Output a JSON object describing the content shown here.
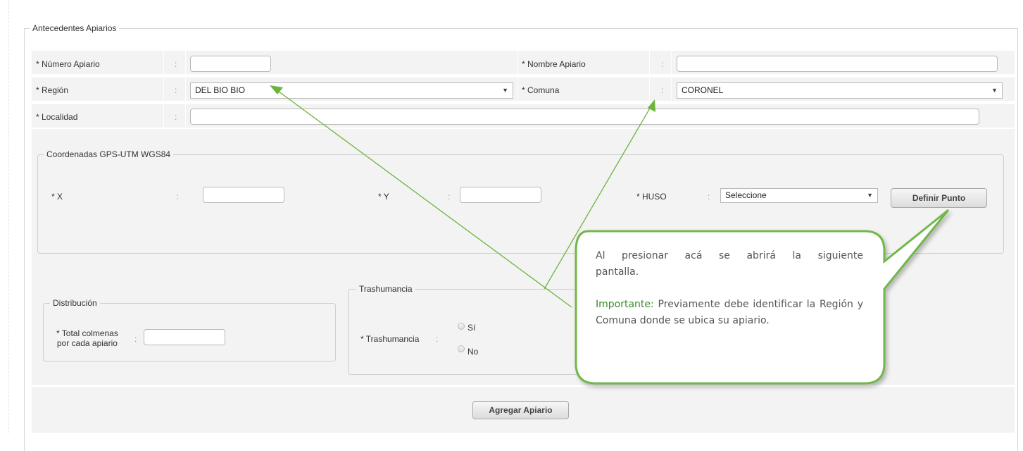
{
  "section_title": "Antecedentes Apiarios",
  "fields": {
    "numero_apiario": {
      "label": "* Número Apiario",
      "value": ""
    },
    "nombre_apiario": {
      "label": "* Nombre Apiario",
      "value": ""
    },
    "region": {
      "label": "* Región",
      "value": "DEL BIO BIO"
    },
    "comuna": {
      "label": "* Comuna",
      "value": "CORONEL"
    },
    "localidad": {
      "label": "* Localidad",
      "value": ""
    },
    "colon": ":"
  },
  "gps": {
    "title": "Coordenadas GPS-UTM WGS84",
    "x_label": "* X",
    "y_label": "* Y",
    "huso_label": "* HUSO",
    "huso_value": "Seleccione",
    "define_button": "Definir Punto"
  },
  "distribucion": {
    "title": "Distribución",
    "total_label_line1": "* Total colmenas",
    "total_label_line2": "por cada apiario",
    "total_value": ""
  },
  "trashumancia": {
    "title": "Trashumancia",
    "label": "* Trashumancia",
    "options": [
      "Sí",
      "No"
    ]
  },
  "add_button": "Agregar Apiario",
  "callout": {
    "line1": "Al presionar acá se abrirá la siguiente",
    "line2": "pantalla.",
    "important_label": "Importante:",
    "important_text": " Previamente debe identificar la Región y Comuna donde se ubica su apiario."
  },
  "colors": {
    "callout_border": "#72b74a",
    "arrow": "#6db33f",
    "important": "#3a8a2a"
  },
  "icons": {
    "select_arrow": "▼"
  }
}
